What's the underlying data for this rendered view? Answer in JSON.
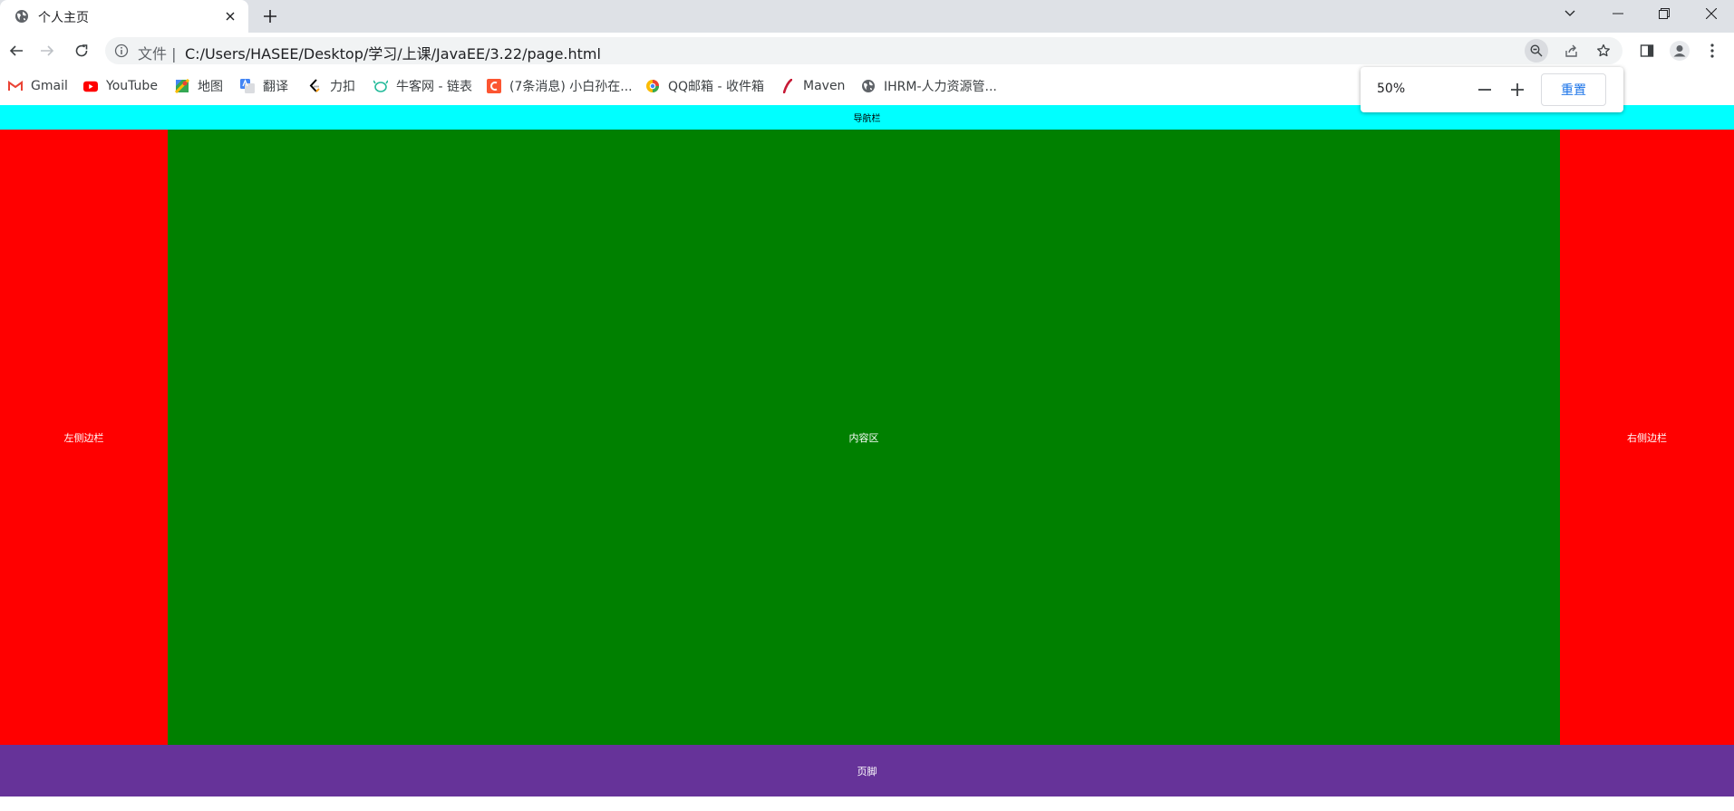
{
  "tab": {
    "title": "个人主页"
  },
  "address_bar": {
    "scheme_label": "文件 |",
    "url": "C:/Users/HASEE/Desktop/学习/上课/JavaEE/3.22/page.html"
  },
  "bookmarks": [
    {
      "label": "Gmail",
      "icon": "gmail-icon"
    },
    {
      "label": "YouTube",
      "icon": "youtube-icon"
    },
    {
      "label": "地图",
      "icon": "maps-icon"
    },
    {
      "label": "翻译",
      "icon": "translate-icon"
    },
    {
      "label": "力扣",
      "icon": "leetcode-icon"
    },
    {
      "label": "牛客网 - 链表",
      "icon": "nowcoder-icon"
    },
    {
      "label": "(7条消息) 小白孙在...",
      "icon": "csdn-icon"
    },
    {
      "label": "QQ邮箱 - 收件箱",
      "icon": "qqmail-icon"
    },
    {
      "label": "Maven",
      "icon": "maven-icon"
    },
    {
      "label": "IHRM-人力资源管...",
      "icon": "globe-icon"
    }
  ],
  "zoom_popup": {
    "percent": "50%",
    "reset_label": "重置"
  },
  "page": {
    "nav": "导航栏",
    "left_sidebar": "左侧边栏",
    "content": "内容区",
    "right_sidebar": "右侧边栏",
    "footer": "页脚"
  },
  "colors": {
    "nav": "#00ffff",
    "sidebar": "#ff0000",
    "content": "#008000",
    "footer": "#663399",
    "accent": "#1a73e8"
  }
}
